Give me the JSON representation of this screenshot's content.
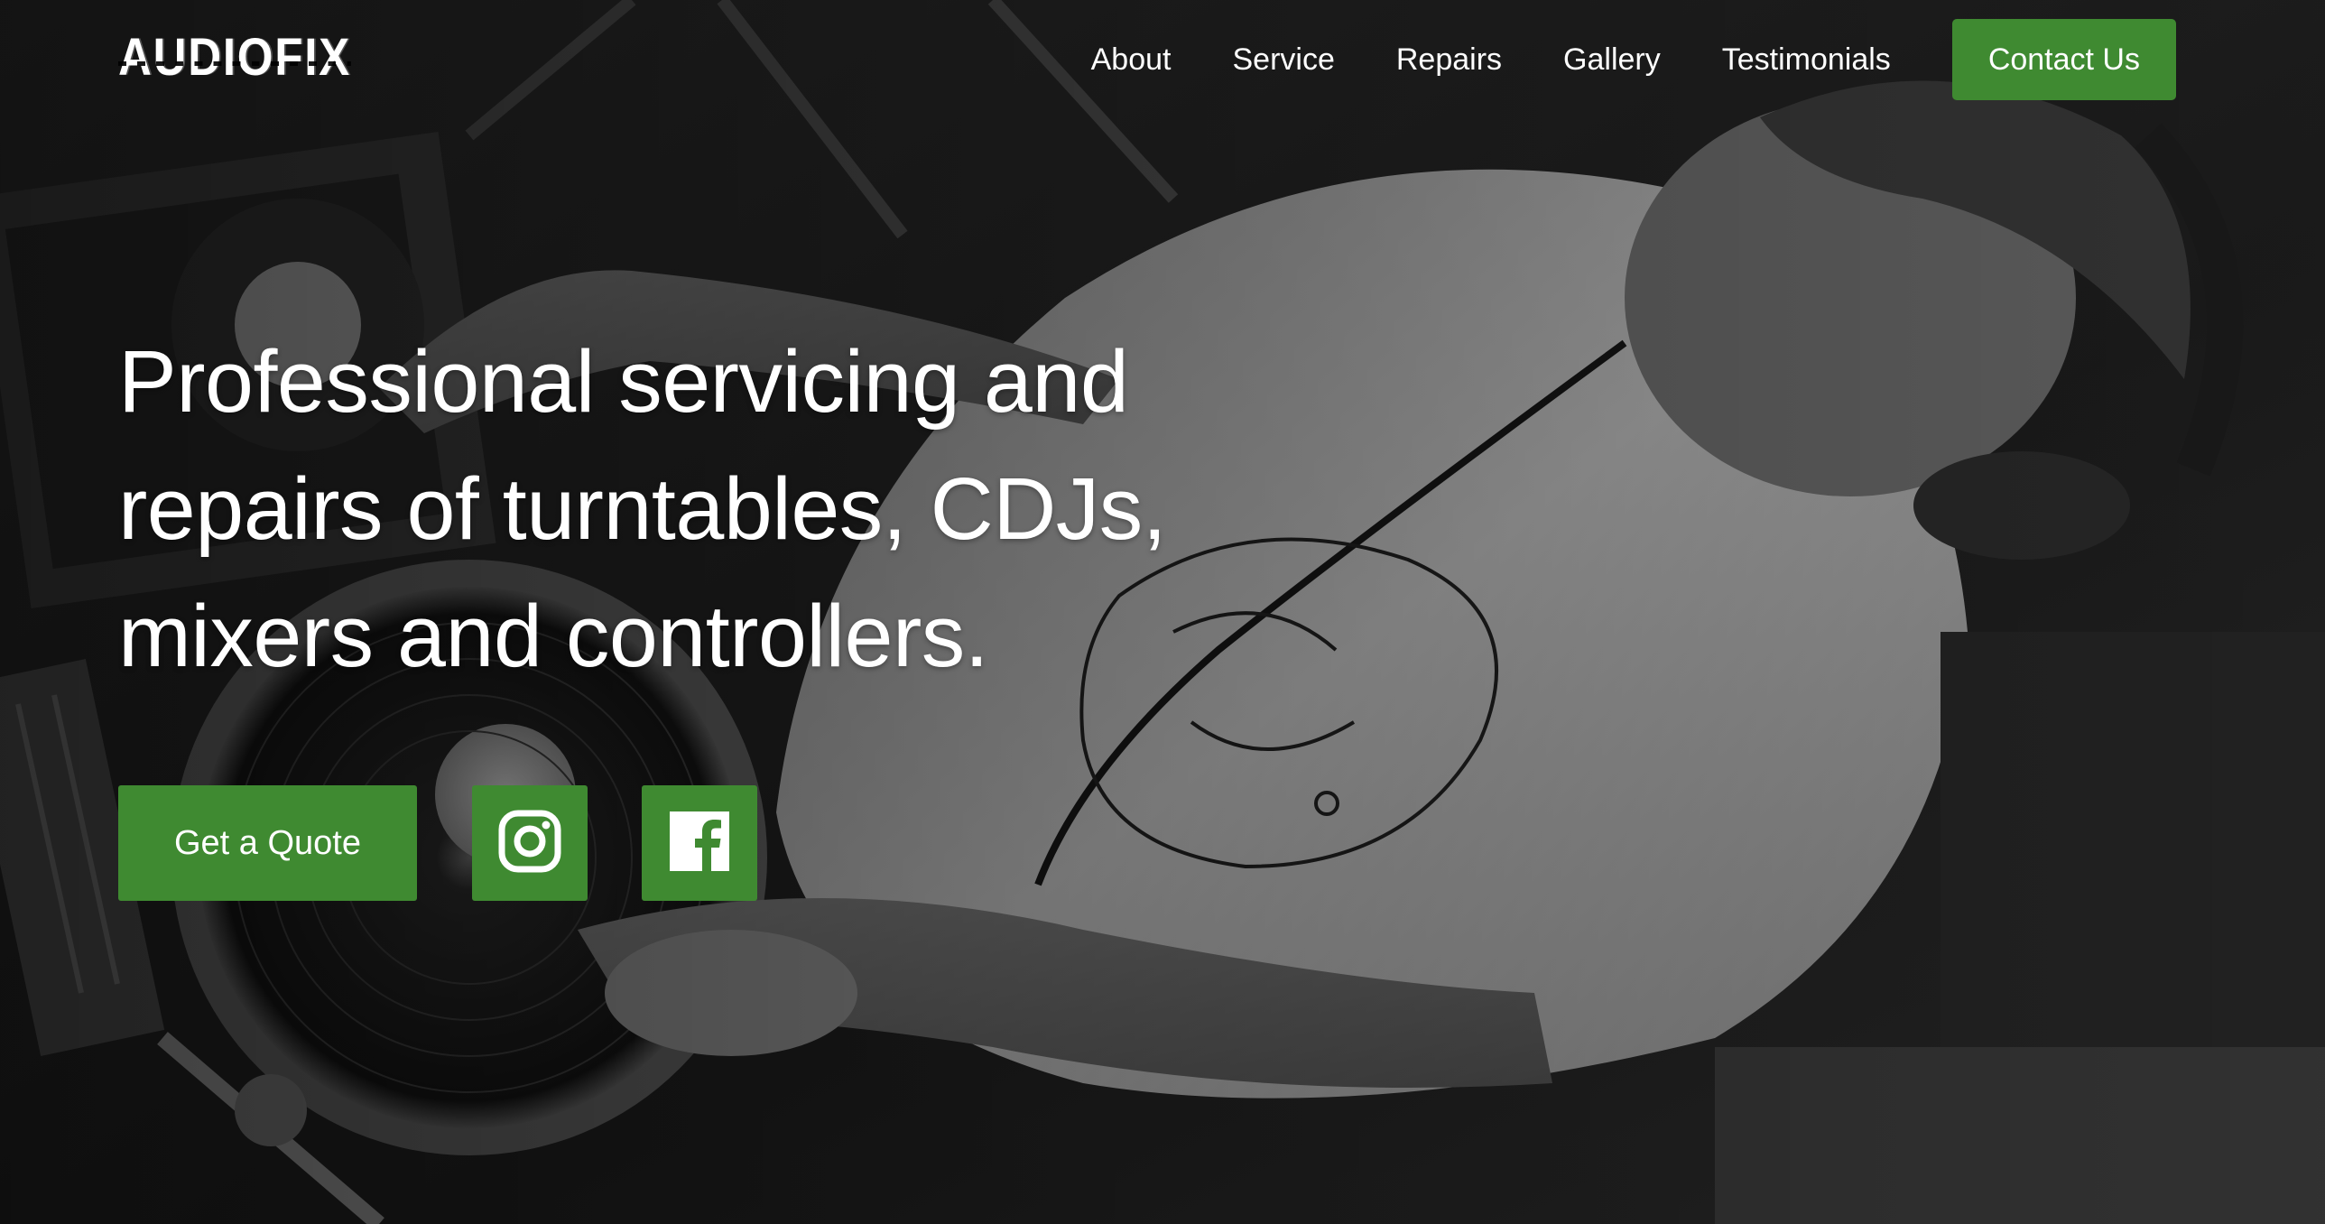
{
  "header": {
    "logo_text": "AUDIOFIX",
    "nav": [
      {
        "label": "About"
      },
      {
        "label": "Service"
      },
      {
        "label": "Repairs"
      },
      {
        "label": "Gallery"
      },
      {
        "label": "Testimonials"
      }
    ],
    "contact_label": "Contact Us"
  },
  "hero": {
    "headline_lines": [
      "Professional servicing and",
      "repairs of turntables, CDJs,",
      "mixers and controllers."
    ],
    "quote_label": "Get a Quote",
    "social": [
      {
        "icon": "instagram-icon"
      },
      {
        "icon": "facebook-icon"
      }
    ],
    "background_description": "Black and white photo of a DJ with headphones at turntables"
  },
  "colors": {
    "accent": "#3f8a31",
    "text": "#ffffff",
    "background": "#1b1b1b"
  }
}
